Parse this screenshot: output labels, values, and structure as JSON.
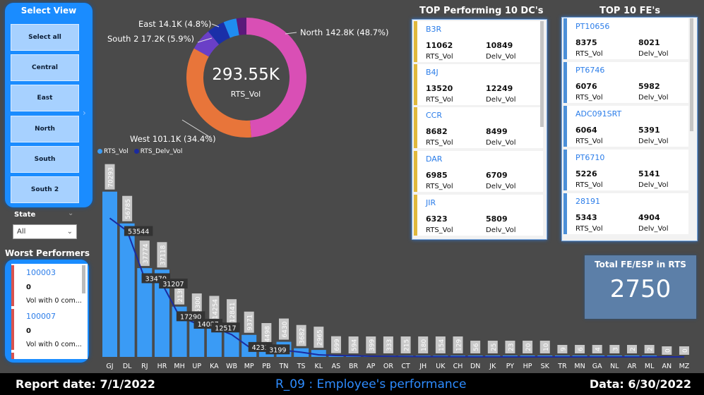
{
  "slicer": {
    "title": "Select View",
    "buttons": [
      "Select all",
      "Central",
      "East",
      "North",
      "South",
      "South 2"
    ]
  },
  "state_filter": {
    "label": "State",
    "value": "All"
  },
  "worst": {
    "title": "Worst Performers",
    "items": [
      {
        "id": "100003",
        "value": "0",
        "sub": "Vol with 0 com..."
      },
      {
        "id": "100007",
        "value": "0",
        "sub": "Vol with 0 com..."
      }
    ]
  },
  "donut": {
    "center_value": "293.55K",
    "center_label": "RTS_Vol",
    "slices": [
      {
        "name": "North",
        "label": "North 142.8K (48.7%)",
        "pct": 48.7,
        "color": "#d94fb5"
      },
      {
        "name": "West",
        "label": "West 101.1K (34.4%)",
        "pct": 34.4,
        "color": "#e8753a"
      },
      {
        "name": "South 2",
        "label": "South 2 17.2K (5.9%)",
        "pct": 5.9,
        "color": "#6a3fc7"
      },
      {
        "name": "East",
        "label": "East 14.1K (4.8%)",
        "pct": 4.8,
        "color": "#1a2fa8"
      },
      {
        "name": "Central",
        "label": "",
        "pct": 3.5,
        "color": "#1f8cf0"
      },
      {
        "name": "South",
        "label": "",
        "pct": 2.7,
        "color": "#5a1a7a"
      }
    ]
  },
  "legend": [
    {
      "label": "RTS_Vol",
      "color": "#3a9bf5"
    },
    {
      "label": "RTS_Delv_Vol",
      "color": "#1b2a9e"
    }
  ],
  "chart_data": {
    "type": "bar",
    "categories": [
      "GJ",
      "DL",
      "RJ",
      "HR",
      "MH",
      "UP",
      "KA",
      "WB",
      "MP",
      "PB",
      "TN",
      "TS",
      "KL",
      "AS",
      "BR",
      "AP",
      "OR",
      "CT",
      "JH",
      "UK",
      "CH",
      "DN",
      "JK",
      "PY",
      "HP",
      "SK",
      "TR",
      "MN",
      "GA",
      "NL",
      "AR",
      "ML",
      "AN",
      "MZ"
    ],
    "series": [
      {
        "name": "RTS_Vol",
        "values": [
          70293,
          56785,
          37774,
          37118,
          21399,
          15300,
          14254,
          12841,
          9371,
          4498,
          6430,
          3682,
          2965,
          699,
          594,
          399,
          333,
          215,
          180,
          154,
          129,
          56,
          25,
          23,
          20,
          10,
          9,
          6,
          4,
          3,
          2,
          2,
          0,
          0
        ]
      },
      {
        "name": "RTS_Delv_Vol",
        "labels_shown": [
          53544,
          33470,
          31207,
          17290,
          14087,
          12517,
          4233,
          3199
        ],
        "values": [
          59000,
          53544,
          33470,
          31207,
          17290,
          14087,
          12517,
          9500,
          4233,
          3199,
          2800,
          2000,
          900,
          600,
          500,
          300,
          250,
          180,
          120,
          100,
          80,
          40,
          20,
          18,
          15,
          8,
          6,
          4,
          3,
          2,
          1,
          1,
          0,
          0
        ]
      }
    ],
    "ylim": [
      0,
      72000
    ]
  },
  "dc_panel": {
    "title": "TOP Performing 10 DC's",
    "cards": [
      {
        "id": "B3R",
        "v1": "11062",
        "l1": "RTS_Vol",
        "v2": "10849",
        "l2": "Delv_Vol"
      },
      {
        "id": "B4J",
        "v1": "13520",
        "l1": "RTS_Vol",
        "v2": "12249",
        "l2": "Delv_Vol"
      },
      {
        "id": "CCR",
        "v1": "8682",
        "l1": "RTS_Vol",
        "v2": "8499",
        "l2": "Delv_Vol"
      },
      {
        "id": "DAR",
        "v1": "6985",
        "l1": "RTS_Vol",
        "v2": "6709",
        "l2": "Delv_Vol"
      },
      {
        "id": "JIR",
        "v1": "6323",
        "l1": "RTS_Vol",
        "v2": "5809",
        "l2": "Delv_Vol"
      }
    ]
  },
  "fe_panel": {
    "title": "TOP 10 FE's",
    "cards": [
      {
        "id": "PT10656",
        "v1": "8375",
        "l1": "RTS_Vol",
        "v2": "8021",
        "l2": "Delv_Vol"
      },
      {
        "id": "PT6746",
        "v1": "6076",
        "l1": "RTS_Vol",
        "v2": "5982",
        "l2": "Delv_Vol"
      },
      {
        "id": "ADC091SRT",
        "v1": "6064",
        "l1": "RTS_Vol",
        "v2": "5391",
        "l2": "Delv_Vol"
      },
      {
        "id": "PT6710",
        "v1": "5226",
        "l1": "RTS_Vol",
        "v2": "5141",
        "l2": "Delv_Vol"
      },
      {
        "id": "28191",
        "v1": "5343",
        "l1": "RTS_Vol",
        "v2": "4904",
        "l2": "Delv_Vol"
      }
    ]
  },
  "total": {
    "title": "Total FE/ESP in RTS",
    "value": "2750"
  },
  "footer": {
    "report_date": "Report date: 7/1/2022",
    "page_title": "R_09 : Employee's performance",
    "data_date": "Data: 6/30/2022"
  }
}
